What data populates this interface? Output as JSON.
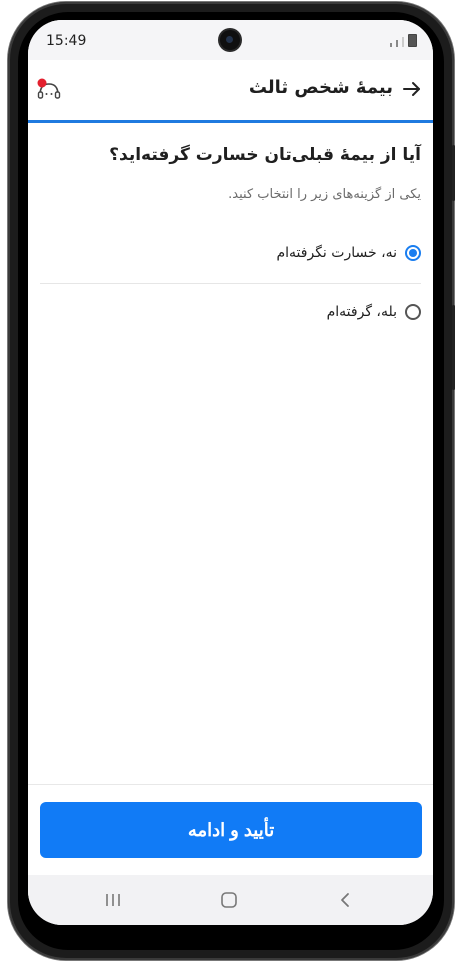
{
  "status_bar": {
    "time": "15:49"
  },
  "header": {
    "title": "بیمهٔ شخص ثالث"
  },
  "question": {
    "title": "آیا از بیمهٔ قبلی‌تان خسارت گرفته‌اید؟",
    "subtitle": "یکی از گزینه‌های زیر را انتخاب کنید."
  },
  "options": [
    {
      "label": "نه، خسارت نگرفته‌ام",
      "selected": true
    },
    {
      "label": "بله، گرفته‌ام",
      "selected": false
    }
  ],
  "confirm_button": {
    "label": "تأیید و ادامه"
  },
  "colors": {
    "accent": "#117bf6",
    "progress": "#1f7ae0"
  },
  "icons": {
    "back": "arrow-right-icon",
    "support": "support-avatar-icon",
    "nav_recent": "recent-apps-icon",
    "nav_home": "home-icon",
    "nav_back": "back-icon"
  }
}
